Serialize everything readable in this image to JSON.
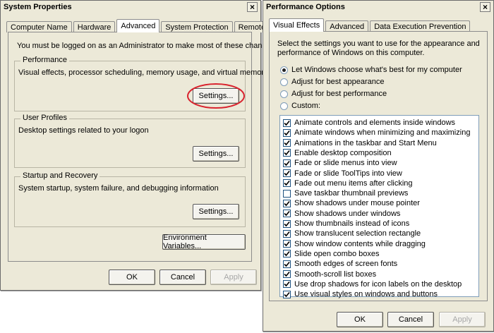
{
  "system_properties": {
    "title": "System Properties",
    "close_glyph": "×",
    "tabs": [
      "Computer Name",
      "Hardware",
      "Advanced",
      "System Protection",
      "Remote"
    ],
    "admin_note": "You must be logged on as an Administrator to make most of these changes.",
    "performance": {
      "title": "Performance",
      "description": "Visual effects, processor scheduling, memory usage, and virtual memory",
      "button": "Settings..."
    },
    "user_profiles": {
      "title": "User Profiles",
      "description": "Desktop settings related to your logon",
      "button": "Settings..."
    },
    "startup_recovery": {
      "title": "Startup and Recovery",
      "description": "System startup, system failure, and debugging information",
      "button": "Settings..."
    },
    "env_button": "Environment Variables...",
    "ok": "OK",
    "cancel": "Cancel",
    "apply": "Apply",
    "highlight_color": "#d9232e"
  },
  "performance_options": {
    "title": "Performance Options",
    "close_glyph": "×",
    "tabs": [
      "Visual Effects",
      "Advanced",
      "Data Execution Prevention"
    ],
    "intro": [
      "Select the settings you want to use for the appearance and",
      "performance of Windows on this computer."
    ],
    "radios": [
      {
        "label": "Let Windows choose what's best for my computer",
        "selected": true
      },
      {
        "label": "Adjust for best appearance",
        "selected": false
      },
      {
        "label": "Adjust for best performance",
        "selected": false
      },
      {
        "label": "Custom:",
        "selected": false
      }
    ],
    "effects": [
      {
        "label": "Animate controls and elements inside windows",
        "checked": true
      },
      {
        "label": "Animate windows when minimizing and maximizing",
        "checked": true
      },
      {
        "label": "Animations in the taskbar and Start Menu",
        "checked": true
      },
      {
        "label": "Enable desktop composition",
        "checked": true
      },
      {
        "label": "Fade or slide menus into view",
        "checked": true
      },
      {
        "label": "Fade or slide ToolTips into view",
        "checked": true
      },
      {
        "label": "Fade out menu items after clicking",
        "checked": true
      },
      {
        "label": "Save taskbar thumbnail previews",
        "checked": false
      },
      {
        "label": "Show shadows under mouse pointer",
        "checked": true
      },
      {
        "label": "Show shadows under windows",
        "checked": true
      },
      {
        "label": "Show thumbnails instead of icons",
        "checked": true
      },
      {
        "label": "Show translucent selection rectangle",
        "checked": true
      },
      {
        "label": "Show window contents while dragging",
        "checked": true
      },
      {
        "label": "Slide open combo boxes",
        "checked": true
      },
      {
        "label": "Smooth edges of screen fonts",
        "checked": true
      },
      {
        "label": "Smooth-scroll list boxes",
        "checked": true
      },
      {
        "label": "Use drop shadows for icon labels on the desktop",
        "checked": true
      },
      {
        "label": "Use visual styles on windows and buttons",
        "checked": true
      }
    ],
    "ok": "OK",
    "cancel": "Cancel",
    "apply": "Apply"
  }
}
